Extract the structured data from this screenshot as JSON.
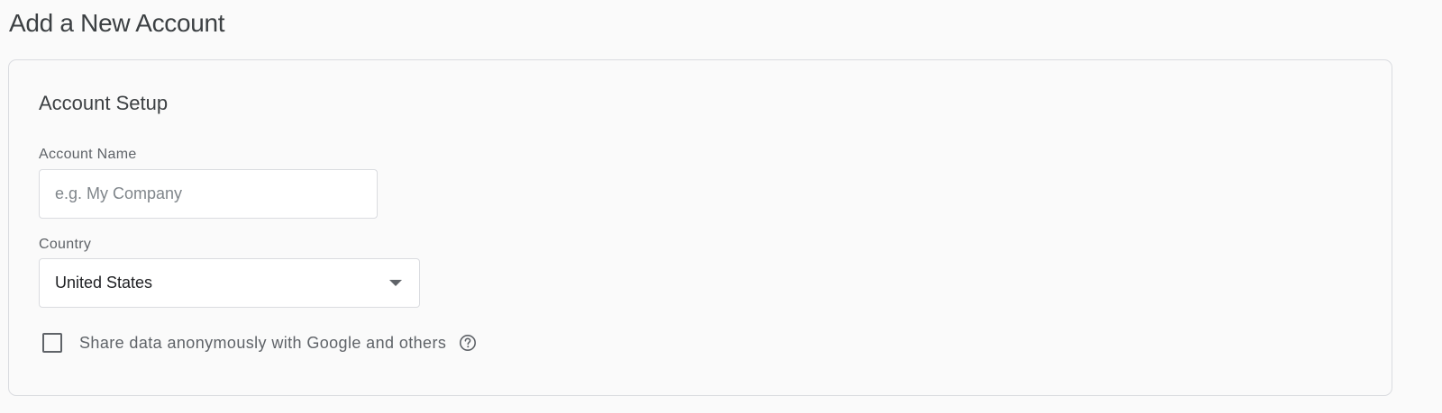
{
  "page": {
    "title": "Add a New Account"
  },
  "account_setup": {
    "title": "Account Setup",
    "account_name": {
      "label": "Account Name",
      "value": "",
      "placeholder": "e.g. My Company"
    },
    "country": {
      "label": "Country",
      "selected": "United States"
    },
    "share_data": {
      "label": "Share data anonymously with Google and others",
      "checked": false,
      "icon": "help-circle-icon"
    }
  },
  "colors": {
    "background": "#fafafa",
    "border": "#dadce0",
    "secondary_text": "#5f6368",
    "primary_text": "#202124"
  }
}
